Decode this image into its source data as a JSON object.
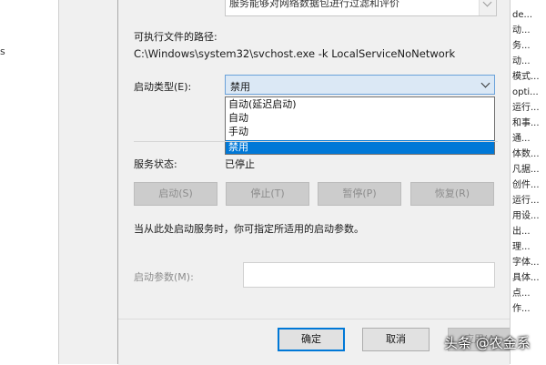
{
  "background": {
    "left_mark": "s"
  },
  "dialog": {
    "description_text": "服务能够对网络数据包进行过滤和评价",
    "path_label": "可执行文件的路径:",
    "path_value": "C:\\Windows\\system32\\svchost.exe -k LocalServiceNoNetwork",
    "startup_type_label": "启动类型(E):",
    "startup_type_value": "禁用",
    "startup_options": [
      {
        "label": "自动(延迟启动)",
        "selected": false
      },
      {
        "label": "自动",
        "selected": false
      },
      {
        "label": "手动",
        "selected": false
      },
      {
        "label": "禁用",
        "selected": true
      }
    ],
    "service_status_label": "服务状态:",
    "service_status_value": "已停止",
    "buttons": {
      "start": "启动(S)",
      "stop": "停止(T)",
      "pause": "暂停(P)",
      "resume": "恢复(R)"
    },
    "hint": "当从此处启动服务时，你可指定所适用的启动参数。",
    "params_label": "启动参数(M):",
    "params_value": "",
    "footer": {
      "ok": "确定",
      "cancel": "取消",
      "apply": "应用(A)"
    }
  },
  "right_pane": {
    "rows": [
      "de...",
      "动...",
      "务...",
      "动...",
      "模式...",
      "opti...",
      "运行...",
      "和事...",
      "通...",
      "体数...",
      "凡据...",
      "创件...",
      "运行...",
      "用设...",
      "出...",
      "理...",
      "字体...",
      "具体...",
      "点...",
      "作..."
    ]
  },
  "watermark": "头条 @农金系",
  "colors": {
    "accent": "#0078d7",
    "dialog_bg": "#f0f0f0",
    "disabled_text": "#8c8c8c"
  }
}
